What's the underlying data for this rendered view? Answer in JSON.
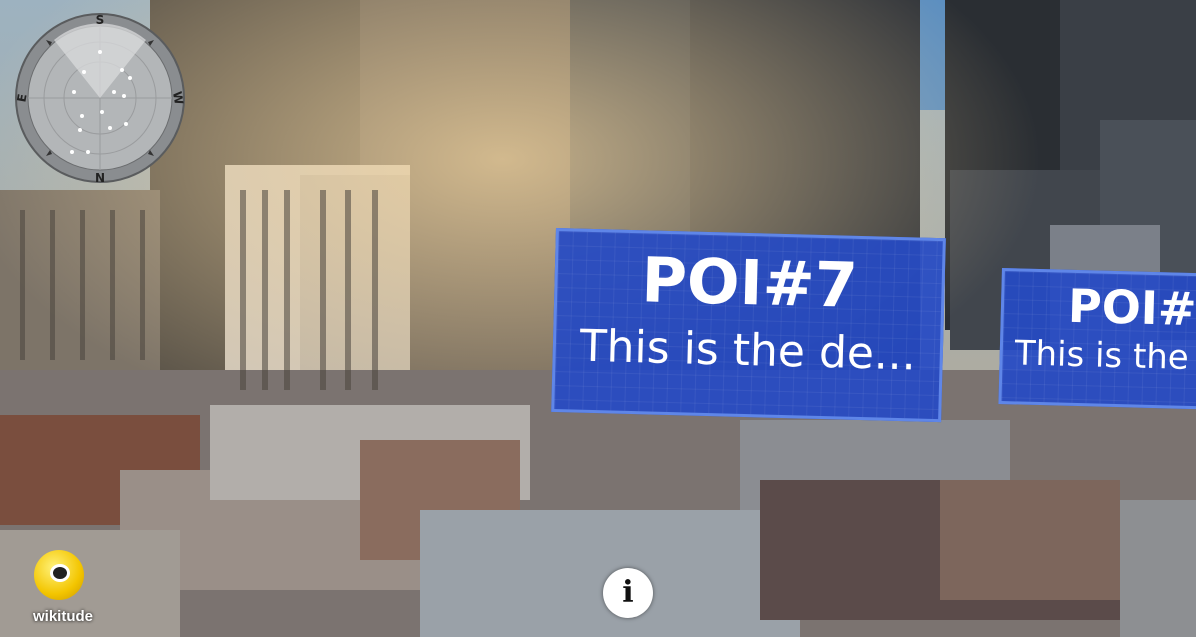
{
  "radar": {
    "labels": {
      "top": "S",
      "bottom": "N",
      "left": "E",
      "right": "W"
    }
  },
  "pois": [
    {
      "title": "POI#7",
      "description": "This is the de..."
    },
    {
      "title": "POI#",
      "description": "This is the"
    }
  ],
  "logo": {
    "name": "wikitude"
  },
  "info_button": {
    "label": "i"
  },
  "colors": {
    "poi_fill": "#2a4cc4",
    "poi_border": "#5f86e8",
    "logo_yellow": "#f3c500"
  }
}
